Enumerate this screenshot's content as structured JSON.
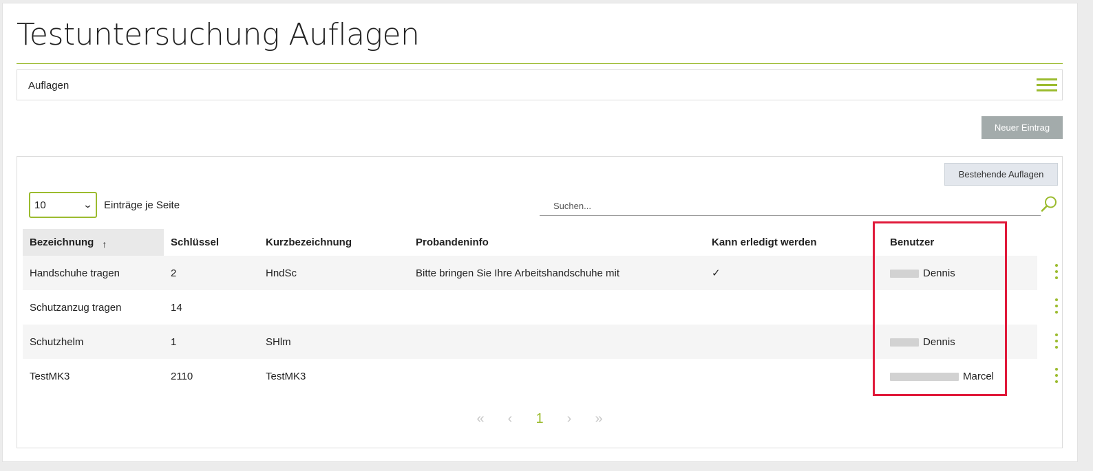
{
  "page": {
    "title": "Testuntersuchung Auflagen",
    "section_title": "Auflagen",
    "accent_color": "#9bbb2e",
    "highlight_color": "#e0193a"
  },
  "toolbar": {
    "new_entry_label": "Neuer Eintrag",
    "existing_label": "Bestehende Auflagen"
  },
  "list_controls": {
    "page_size_value": "10",
    "page_size_label": "Einträge je Seite",
    "search_placeholder": "Suchen..."
  },
  "table": {
    "columns": [
      "Bezeichnung",
      "Schlüssel",
      "Kurzbezeichnung",
      "Probandeninfo",
      "Kann erledigt werden",
      "Benutzer"
    ],
    "sort_indicator": "↑",
    "rows": [
      {
        "bezeichnung": "Handschuhe tragen",
        "schluessel": "2",
        "kurz": "HndSc",
        "info": "Bitte bringen Sie Ihre Arbeitshandschuhe mit",
        "erledigt": "✓",
        "benutzer": "Dennis"
      },
      {
        "bezeichnung": "Schutzanzug tragen",
        "schluessel": "14",
        "kurz": "",
        "info": "",
        "erledigt": "",
        "benutzer": ""
      },
      {
        "bezeichnung": "Schutzhelm",
        "schluessel": "1",
        "kurz": "SHlm",
        "info": "",
        "erledigt": "",
        "benutzer": "Dennis"
      },
      {
        "bezeichnung": "TestMK3",
        "schluessel": "2110",
        "kurz": "TestMK3",
        "info": "",
        "erledigt": "",
        "benutzer": "Marcel"
      }
    ]
  },
  "pagination": {
    "first": "«",
    "prev": "‹",
    "current": "1",
    "next": "›",
    "last": "»"
  },
  "icons": [
    "hamburger-menu-icon",
    "search-icon",
    "kebab-menu-icon",
    "chevron-down-icon"
  ]
}
